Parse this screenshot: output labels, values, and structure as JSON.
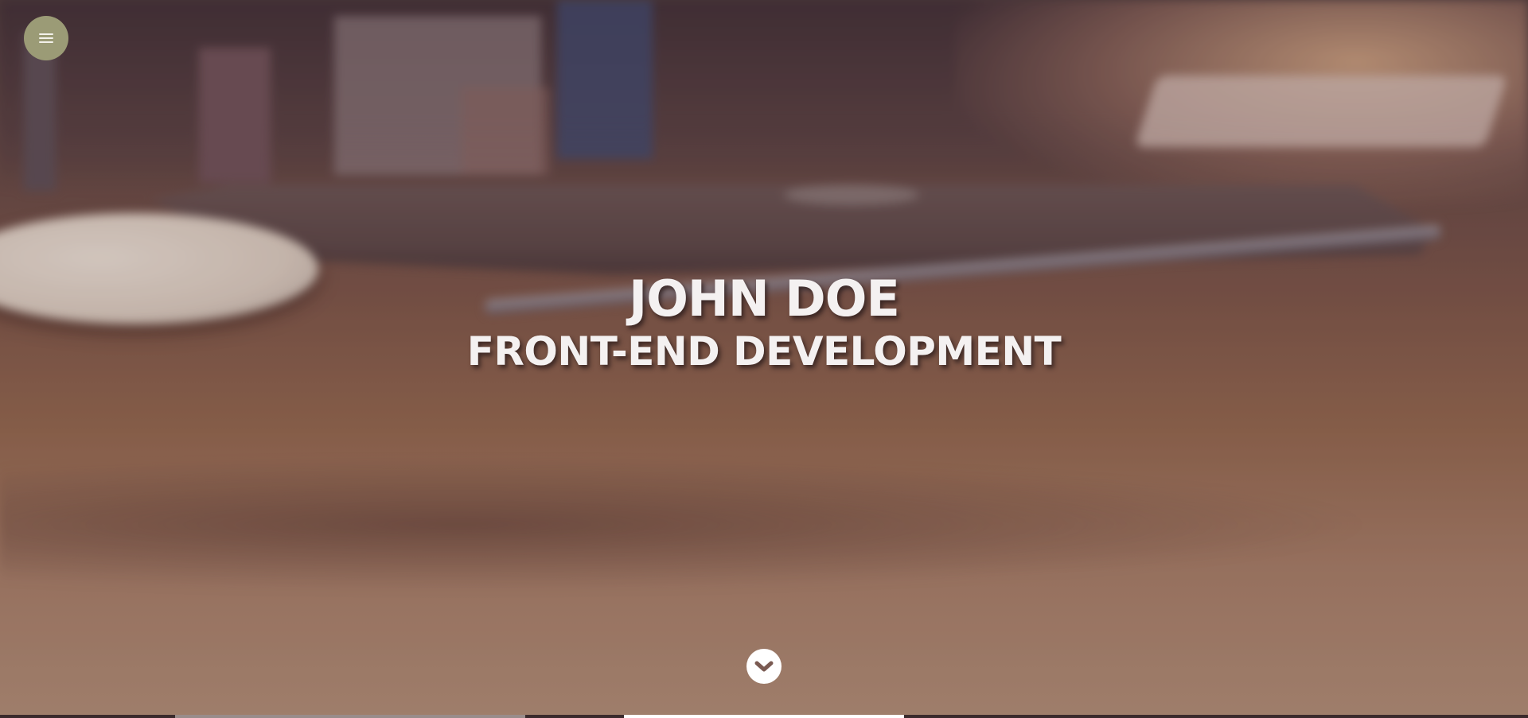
{
  "nav": {
    "menu_icon": "hamburger-icon"
  },
  "hero": {
    "name": "JOHN DOE",
    "role": "FRONT-END DEVELOPMENT",
    "scroll_icon": "chevron-down-icon"
  },
  "colors": {
    "menu_button_bg": "#9b9b76",
    "title_text": "#f4f1f1",
    "scroll_button_bg": "#ffffff"
  }
}
